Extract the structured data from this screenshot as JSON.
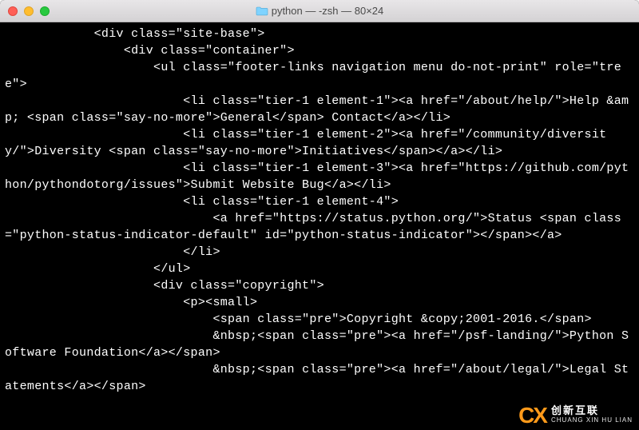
{
  "window": {
    "title": "python — -zsh — 80×24",
    "traffic": {
      "close": "close",
      "minimize": "minimize",
      "zoom": "zoom"
    }
  },
  "terminal": {
    "lines": [
      "            <div class=\"site-base\">",
      "                <div class=\"container\">",
      "",
      "                    <ul class=\"footer-links navigation menu do-not-print\" role=\"tree\">",
      "                        <li class=\"tier-1 element-1\"><a href=\"/about/help/\">Help &amp; <span class=\"say-no-more\">General</span> Contact</a></li>",
      "                        <li class=\"tier-1 element-2\"><a href=\"/community/diversity/\">Diversity <span class=\"say-no-more\">Initiatives</span></a></li>",
      "                        <li class=\"tier-1 element-3\"><a href=\"https://github.com/python/pythondotorg/issues\">Submit Website Bug</a></li>",
      "                        <li class=\"tier-1 element-4\">",
      "                            <a href=\"https://status.python.org/\">Status <span class=\"python-status-indicator-default\" id=\"python-status-indicator\"></span></a>",
      "                        </li>",
      "                    </ul>",
      "",
      "                    <div class=\"copyright\">",
      "                        <p><small>",
      "                            <span class=\"pre\">Copyright &copy;2001-2016.</span>",
      "                            &nbsp;<span class=\"pre\"><a href=\"/psf-landing/\">Python Software Foundation</a></span>",
      "                            &nbsp;<span class=\"pre\"><a href=\"/about/legal/\">Legal Statements</a></span>"
    ]
  },
  "watermark": {
    "logo": "CX",
    "name_cn": "创新互联",
    "name_py": "CHUANG XIN HU LIAN"
  }
}
